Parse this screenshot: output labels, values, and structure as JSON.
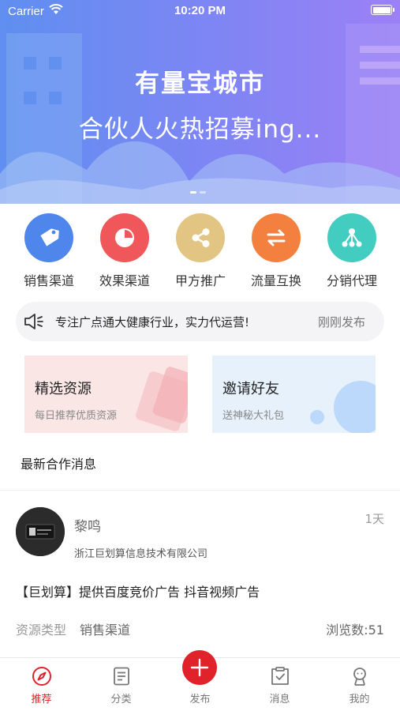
{
  "status_bar": {
    "carrier": "Carrier",
    "time": "10:20 PM"
  },
  "banner": {
    "line1": "有量宝城市",
    "line2": "合伙人火热招募ing...",
    "page_count": 2,
    "active_page": 0
  },
  "categories": [
    {
      "label": "销售渠道",
      "icon": "tag-icon",
      "color": "#4f86ec"
    },
    {
      "label": "效果渠道",
      "icon": "pie-chart-icon",
      "color": "#f0575a"
    },
    {
      "label": "甲方推广",
      "icon": "share-icon",
      "color": "#e2c483"
    },
    {
      "label": "流量互换",
      "icon": "swap-icon",
      "color": "#f3803e"
    },
    {
      "label": "分销代理",
      "icon": "network-icon",
      "color": "#43ccc0"
    }
  ],
  "notice": {
    "icon": "speaker-icon",
    "text": "专注广点通大健康行业，实力代运营!",
    "time": "刚刚发布"
  },
  "cards": [
    {
      "title": "精选资源",
      "subtitle": "每日推荐优质资源"
    },
    {
      "title": "邀请好友",
      "subtitle": "送神秘大礼包"
    }
  ],
  "section_title": "最新合作消息",
  "post": {
    "name": "黎鸣",
    "age": "1天",
    "company": "浙江巨划算信息技术有限公司",
    "title": "【巨划算】提供百度竞价广告 抖音视频广告",
    "type_key": "资源类型",
    "type_value": "销售渠道",
    "views": "浏览数:51"
  },
  "tabbar": {
    "accent": "#e0222a",
    "items": [
      {
        "label": "推荐",
        "icon": "compass-icon",
        "active": true
      },
      {
        "label": "分类",
        "icon": "document-icon",
        "active": false
      },
      {
        "label": "发布",
        "icon": "plus-icon",
        "active": false
      },
      {
        "label": "消息",
        "icon": "inbox-icon",
        "active": false
      },
      {
        "label": "我的",
        "icon": "profile-icon",
        "active": false
      }
    ]
  }
}
